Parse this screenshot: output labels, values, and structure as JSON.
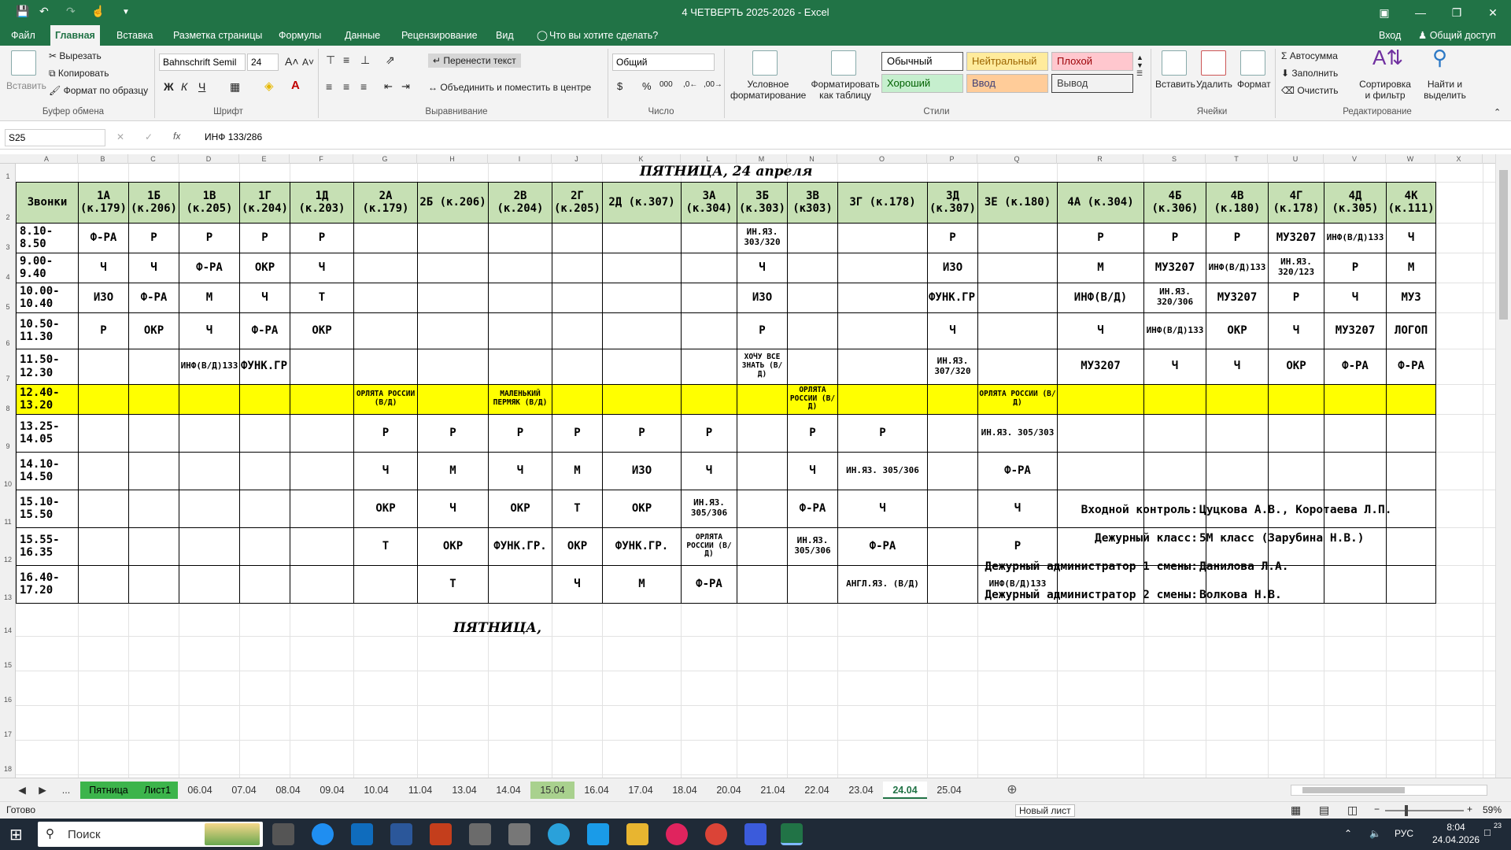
{
  "window": {
    "title": "4 ЧЕТВЕРТЬ 2025-2026 - Excel",
    "sign_in": "Вход",
    "share": "Общий доступ"
  },
  "tabs": [
    "Файл",
    "Главная",
    "Вставка",
    "Разметка страницы",
    "Формулы",
    "Данные",
    "Рецензирование",
    "Вид",
    "Что вы хотите сделать?"
  ],
  "ribbon": {
    "clipboard": {
      "paste": "Вставить",
      "cut": "Вырезать",
      "copy": "Копировать",
      "format_painter": "Формат по образцу",
      "group": "Буфер обмена"
    },
    "font": {
      "name": "Bahnschrift Semil",
      "size": "24",
      "bold": "Ж",
      "italic": "К",
      "underline": "Ч",
      "group": "Шрифт"
    },
    "alignment": {
      "wrap": "Перенести текст",
      "merge": "Объединить и поместить в центре",
      "group": "Выравнивание"
    },
    "number": {
      "format": "Общий",
      "group": "Число"
    },
    "styles": {
      "conditional": "Условное форматирование",
      "as_table": "Форматировать как таблицу",
      "normal": "Обычный",
      "neutral": "Нейтральный",
      "bad": "Плохой",
      "good": "Хороший",
      "input": "Ввод",
      "output": "Вывод",
      "group": "Стили"
    },
    "cells": {
      "insert": "Вставить",
      "delete": "Удалить",
      "format": "Формат",
      "group": "Ячейки"
    },
    "editing": {
      "autosum": "Автосумма",
      "fill": "Заполнить",
      "clear": "Очистить",
      "sort": "Сортировка и фильтр",
      "find": "Найти и выделить",
      "group": "Редактирование"
    }
  },
  "formula_bar": {
    "name_box": "S25",
    "fx": "fx",
    "formula": "ИНФ 133/286"
  },
  "columns": [
    "A",
    "B",
    "C",
    "D",
    "E",
    "F",
    "G",
    "H",
    "I",
    "J",
    "K",
    "L",
    "M",
    "N",
    "O",
    "P",
    "Q",
    "R",
    "S",
    "T",
    "U",
    "V",
    "W",
    "X"
  ],
  "rows": [
    "1",
    "2",
    "3",
    "4",
    "5",
    "6",
    "7",
    "8",
    "9",
    "10",
    "11",
    "12",
    "13",
    "14",
    "15",
    "16",
    "17",
    "18"
  ],
  "schedule": {
    "title": "ПЯТНИЦА, 24 апреля",
    "headers": [
      "Звонки",
      "1А (к.179)",
      "1Б (к.206)",
      "1В (к.205)",
      "1Г (к.204)",
      "1Д (к.203)",
      "2А (к.179)",
      "2Б (к.206)",
      "2В (к.204)",
      "2Г (к.205)",
      "2Д (к.307)",
      "3А (к.304)",
      "3Б (к.303)",
      "3В (к303)",
      "3Г (к.178)",
      "3Д (к.307)",
      "3Е (к.180)",
      "4А (к.304)",
      "4Б (к.306)",
      "4В (к.180)",
      "4Г (к.178)",
      "4Д (к.305)",
      "4К (к.111)"
    ],
    "rows": [
      [
        "8.10-8.50",
        "Ф-РА",
        "Р",
        "Р",
        "Р",
        "Р",
        "",
        "",
        "",
        "",
        "",
        "",
        "ИН.ЯЗ. 303/320",
        "",
        "",
        "Р",
        "",
        "Р",
        "Р",
        "Р",
        "МУЗ207",
        "ИНФ(В/Д)133",
        "Ч"
      ],
      [
        "9.00-9.40",
        "Ч",
        "Ч",
        "Ф-РА",
        "ОКР",
        "Ч",
        "",
        "",
        "",
        "",
        "",
        "",
        "Ч",
        "",
        "",
        "ИЗО",
        "",
        "М",
        "МУЗ207",
        "ИНФ(В/Д)133",
        "ИН.ЯЗ. 320/123",
        "Р",
        "М"
      ],
      [
        "10.00-10.40",
        "ИЗО",
        "Ф-РА",
        "М",
        "Ч",
        "Т",
        "",
        "",
        "",
        "",
        "",
        "",
        "ИЗО",
        "",
        "",
        "ФУНК.ГР.",
        "",
        "ИНФ(В/Д)",
        "ИН.ЯЗ. 320/306",
        "МУЗ207",
        "Р",
        "Ч",
        "МУЗ"
      ],
      [
        "10.50-11.30",
        "Р",
        "ОКР",
        "Ч",
        "Ф-РА",
        "ОКР",
        "",
        "",
        "",
        "",
        "",
        "",
        "Р",
        "",
        "",
        "Ч",
        "",
        "Ч",
        "ИНФ(В/Д)133",
        "ОКР",
        "Ч",
        "МУЗ207",
        "ЛОГОП"
      ],
      [
        "11.50-12.30",
        "",
        "",
        "ИНФ(В/Д)133",
        "ФУНК.ГР.",
        "",
        "",
        "",
        "",
        "",
        "",
        "",
        "ХОЧУ ВСЕ ЗНАТЬ (В/Д)",
        "",
        "",
        "ИН.ЯЗ. 307/320",
        "",
        "МУЗ207",
        "Ч",
        "Ч",
        "ОКР",
        "Ф-РА",
        "Ф-РА"
      ],
      [
        "12.40-13.20",
        "",
        "",
        "",
        "",
        "",
        "ОРЛЯТА РОССИИ (В/Д)",
        "",
        "МАЛЕНЬКИЙ ПЕРМЯК (В/Д)",
        "",
        "",
        "",
        "",
        "ОРЛЯТА РОССИИ (В/Д)",
        "",
        "",
        "ОРЛЯТА РОССИИ (В/Д)",
        "",
        "",
        "",
        "",
        "",
        ""
      ],
      [
        "13.25-14.05",
        "",
        "",
        "",
        "",
        "",
        "Р",
        "Р",
        "Р",
        "Р",
        "Р",
        "Р",
        "",
        "Р",
        "Р",
        "",
        "ИН.ЯЗ. 305/303",
        "",
        "",
        "",
        "",
        "",
        ""
      ],
      [
        "14.10-14.50",
        "",
        "",
        "",
        "",
        "",
        "Ч",
        "М",
        "Ч",
        "М",
        "ИЗО",
        "Ч",
        "",
        "Ч",
        "ИН.ЯЗ. 305/306",
        "",
        "Ф-РА",
        "",
        "",
        "",
        "",
        "",
        ""
      ],
      [
        "15.10-15.50",
        "",
        "",
        "",
        "",
        "",
        "ОКР",
        "Ч",
        "ОКР",
        "Т",
        "ОКР",
        "ИН.ЯЗ. 305/306",
        "",
        "Ф-РА",
        "Ч",
        "",
        "Ч",
        "",
        "",
        "",
        "",
        "",
        ""
      ],
      [
        "15.55-16.35",
        "",
        "",
        "",
        "",
        "",
        "Т",
        "ОКР",
        "ФУНК.ГР.",
        "ОКР",
        "ФУНК.ГР.",
        "ОРЛЯТА РОССИИ (В/Д)",
        "",
        "ИН.ЯЗ. 305/306",
        "Ф-РА",
        "",
        "Р",
        "",
        "",
        "",
        "",
        "",
        ""
      ],
      [
        "16.40-17.20",
        "",
        "",
        "",
        "",
        "",
        "",
        "Т",
        "",
        "Ч",
        "М",
        "Ф-РА",
        "",
        "",
        "АНГЛ.ЯЗ. (В/Д)",
        "",
        "ИНФ(В/Д)133",
        "",
        "",
        "",
        "",
        "",
        ""
      ]
    ],
    "info": [
      {
        "label": "Входной контроль:",
        "value": "Цуцкова А.В., Коротаева Л.П."
      },
      {
        "label": "Дежурный класс:",
        "value": "5М класс (Зарубина Н.В.)"
      },
      {
        "label": "Дежурный администратор 1 смены:",
        "value": "Данилова Л.А."
      },
      {
        "label": "Дежурный администратор 2 смены:",
        "value": "Волкова Н.В."
      }
    ],
    "next_title": "ПЯТНИЦА,"
  },
  "sheet_tabs": [
    "Пятница",
    "Лист1",
    "06.04",
    "07.04",
    "08.04",
    "09.04",
    "10.04",
    "11.04",
    "13.04",
    "14.04",
    "15.04",
    "16.04",
    "17.04",
    "18.04",
    "20.04",
    "21.04",
    "22.04",
    "23.04",
    "24.04",
    "25.04"
  ],
  "status": {
    "ready": "Готово",
    "new_sheet": "Новый лист",
    "zoom": "59%"
  },
  "taskbar": {
    "search": "Поиск",
    "lang": "РУС",
    "time": "8:04",
    "date": "24.04.2026",
    "notif": "23"
  },
  "colors": {
    "excel_green": "#217346",
    "header_fill": "#c6e0b4",
    "highlight": "#ffff00"
  }
}
